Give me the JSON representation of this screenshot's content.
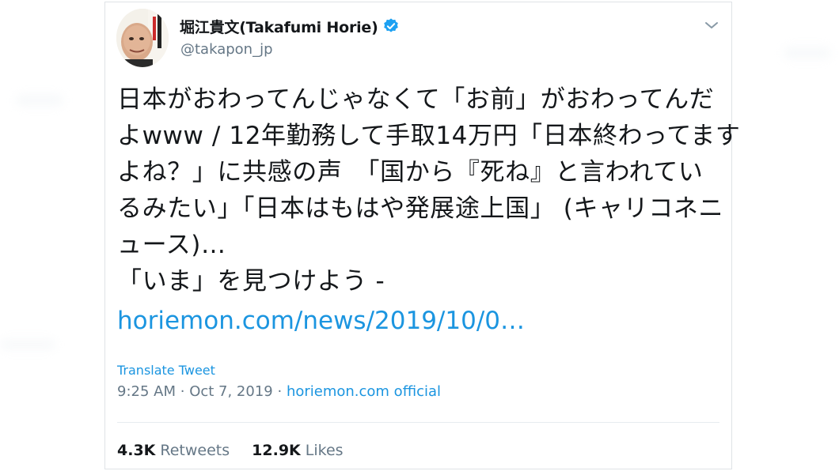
{
  "tweet": {
    "display_name": "堀江貴文(Takafumi Horie)",
    "handle": "@takapon_jp",
    "avatar_caption": "ハッタリの流儀",
    "text_lines": [
      "日本がおわってんじゃなくて「お前」がおわってんだ",
      "よwww / 12年勤務して手取14万円「日本終わってます",
      "よね？」に共感の声　「国から『死ね』と言われてい",
      "るみたい」「日本はもはや発展途上国」 (キャリコネニ",
      "ュース)…",
      "「いま」を見つけよう -"
    ],
    "link": "horiemon.com/news/2019/10/0…",
    "translate_label": "Translate Tweet",
    "time": "9:25 AM",
    "date": "Oct 7, 2019",
    "separator": "·",
    "source": "horiemon.com official",
    "retweets_count": "4.3K",
    "retweets_label": "Retweets",
    "likes_count": "12.9K",
    "likes_label": "Likes"
  },
  "icons": {
    "verified": "verified-badge-icon",
    "menu": "chevron-down-icon"
  },
  "colors": {
    "link_blue": "#1b95e0",
    "text_dark": "#14171a",
    "text_gray": "#657786",
    "border": "#dfe3e6",
    "verified_blue": "#1da1f2"
  }
}
